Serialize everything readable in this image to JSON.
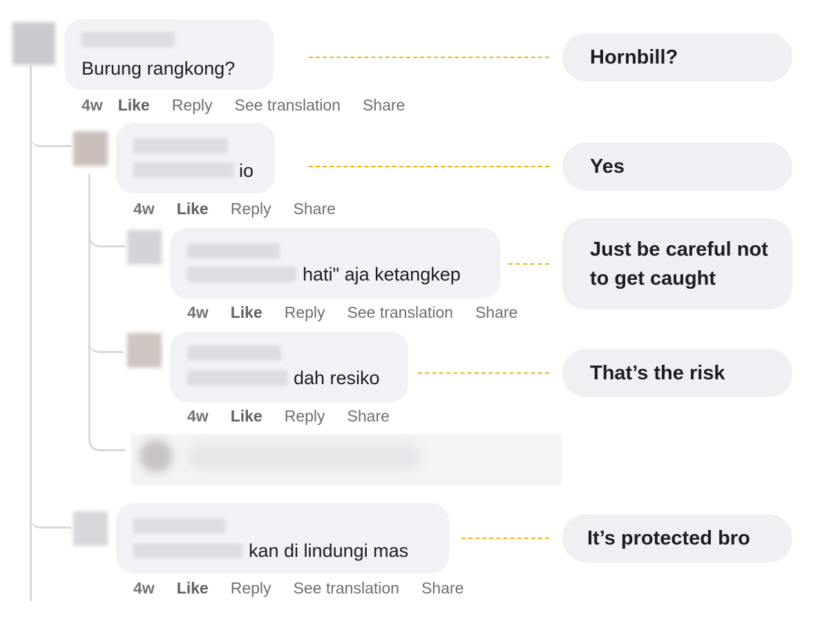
{
  "comments": [
    {
      "text": "Burung rangkong?",
      "time": "4w",
      "like": "Like",
      "reply": "Reply",
      "translate": "See translation",
      "share": "Share"
    },
    {
      "text": "io",
      "time": "4w",
      "like": "Like",
      "reply": "Reply",
      "share": "Share"
    },
    {
      "text": "hati\" aja ketangkep",
      "time": "4w",
      "like": "Like",
      "reply": "Reply",
      "translate": "See translation",
      "share": "Share"
    },
    {
      "text": "dah resiko",
      "time": "4w",
      "like": "Like",
      "reply": "Reply",
      "share": "Share"
    },
    {
      "text": "kan di lindungi mas",
      "time": "4w",
      "like": "Like",
      "reply": "Reply",
      "translate": "See translation",
      "share": "Share"
    }
  ],
  "translations": [
    "Hornbill?",
    "Yes",
    "Just be careful not to get caught",
    "That’s the risk",
    "It’s protected bro"
  ],
  "colors": {
    "bubble": "#f0f2f5",
    "dash": "#f0b400",
    "thread": "#d5d8de"
  }
}
